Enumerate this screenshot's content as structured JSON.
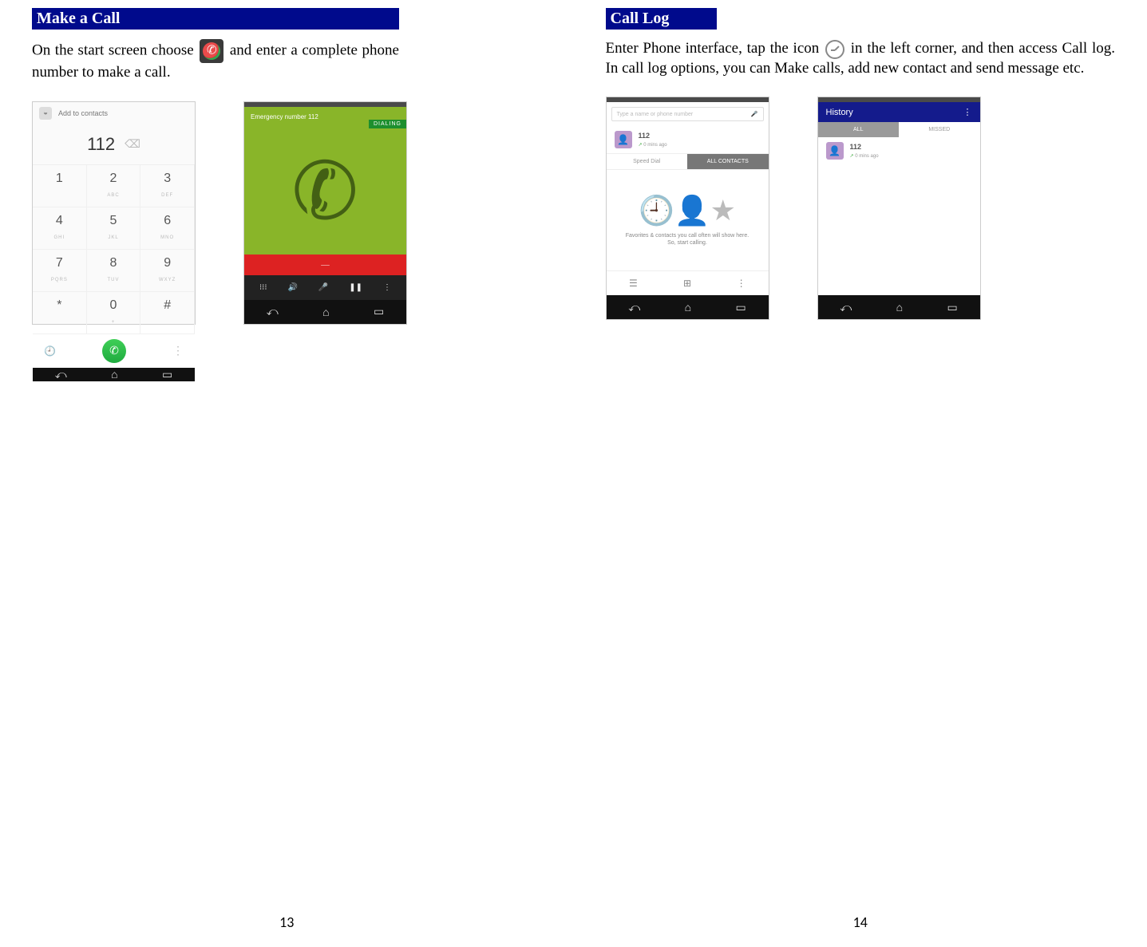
{
  "left": {
    "header": "Make a Call",
    "body_part1": "On the start screen choose ",
    "body_part2": "and enter a complete phone number to make a call.",
    "dialer": {
      "add_to_contacts": "Add to contacts",
      "number": "112",
      "keys": [
        {
          "d": "1",
          "s": ""
        },
        {
          "d": "2",
          "s": "ABC"
        },
        {
          "d": "3",
          "s": "DEF"
        },
        {
          "d": "4",
          "s": "GHI"
        },
        {
          "d": "5",
          "s": "JKL"
        },
        {
          "d": "6",
          "s": "MNO"
        },
        {
          "d": "7",
          "s": "PQRS"
        },
        {
          "d": "8",
          "s": "TUV"
        },
        {
          "d": "9",
          "s": "WXYZ"
        },
        {
          "d": "*",
          "s": ""
        },
        {
          "d": "0",
          "s": "+"
        },
        {
          "d": "#",
          "s": ""
        }
      ]
    },
    "dialing": {
      "title": "Emergency number 112",
      "status": "DIALING"
    },
    "page_number": "13"
  },
  "right": {
    "header": "Call Log",
    "body_part1": "Enter Phone interface, tap the icon ",
    "body_part2": " in the left corner, and then access Call log. In call log options, you can Make calls, add new contact and send message etc.",
    "contacts_shot": {
      "search_placeholder": "Type a name or phone number",
      "entry_number": "112",
      "entry_time": "0 mins ago",
      "tab_speed": "Speed Dial",
      "tab_all": "ALL CONTACTS",
      "empty_text": "Favorites & contacts you call often will show here. So, start calling."
    },
    "history_shot": {
      "title": "History",
      "tab_all": "ALL",
      "tab_missed": "MISSED",
      "entry_number": "112",
      "entry_time": "0 mins ago"
    },
    "page_number": "14"
  }
}
